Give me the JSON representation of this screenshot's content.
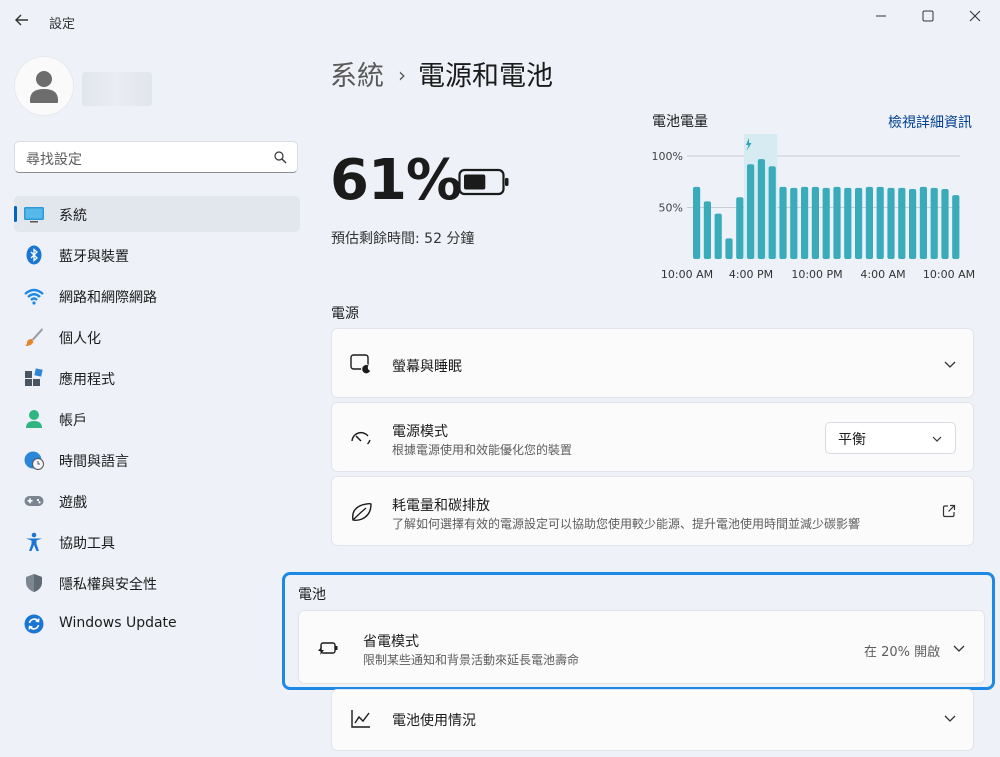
{
  "window": {
    "title": "設定"
  },
  "sidebar": {
    "search_placeholder": "尋找設定",
    "items": [
      {
        "label": "系統",
        "icon": "system-icon"
      },
      {
        "label": "藍牙與裝置",
        "icon": "bluetooth-icon"
      },
      {
        "label": "網路和網際網路",
        "icon": "wifi-icon"
      },
      {
        "label": "個人化",
        "icon": "brush-icon"
      },
      {
        "label": "應用程式",
        "icon": "apps-icon"
      },
      {
        "label": "帳戶",
        "icon": "account-icon"
      },
      {
        "label": "時間與語言",
        "icon": "globe-clock-icon"
      },
      {
        "label": "遊戲",
        "icon": "gamepad-icon"
      },
      {
        "label": "協助工具",
        "icon": "accessibility-icon"
      },
      {
        "label": "隱私權與安全性",
        "icon": "shield-icon"
      },
      {
        "label": "Windows Update",
        "icon": "windows-update-icon"
      }
    ],
    "active_index": 0
  },
  "header": {
    "parent": "系統",
    "separator": "›",
    "title": "電源和電池"
  },
  "battery": {
    "percent_text": "61%",
    "level": 0.61,
    "remaining_label": "預估剩餘時間:",
    "remaining_value": "52 分鐘"
  },
  "chart_data": {
    "type": "bar",
    "title": "電池電量",
    "link": "檢視詳細資訊",
    "y_ticks": [
      "100%",
      "50%"
    ],
    "ylim": [
      0,
      100
    ],
    "x_ticks": [
      "10:00 AM",
      "4:00 PM",
      "10:00 PM",
      "4:00 AM",
      "10:00 AM"
    ],
    "values": [
      70,
      56,
      44,
      20,
      60,
      92,
      97,
      90,
      70,
      69,
      70,
      70,
      69,
      70,
      69,
      69,
      70,
      70,
      69,
      69,
      68,
      70,
      69,
      68,
      62
    ],
    "charging_index": 5,
    "color": "#3aabbb",
    "grid": true
  },
  "power_section": {
    "title": "電源",
    "screen_sleep": {
      "title": "螢幕與睡眠"
    },
    "power_mode": {
      "title": "電源模式",
      "subtitle": "根據電源使用和效能優化您的裝置",
      "value": "平衡"
    },
    "energy": {
      "title": "耗電量和碳排放",
      "subtitle": "了解如何選擇有效的電源設定可以協助您使用較少能源、提升電池使用時間並減少碳影響"
    }
  },
  "battery_section": {
    "title": "電池",
    "saver": {
      "title": "省電模式",
      "subtitle": "限制某些通知和背景活動來延長電池壽命",
      "status": "在 20% 開啟"
    },
    "usage": {
      "title": "電池使用情況"
    }
  },
  "colors": {
    "accent": "#0067c0",
    "focus": "#1e88e5",
    "bar": "#3aabbb"
  }
}
